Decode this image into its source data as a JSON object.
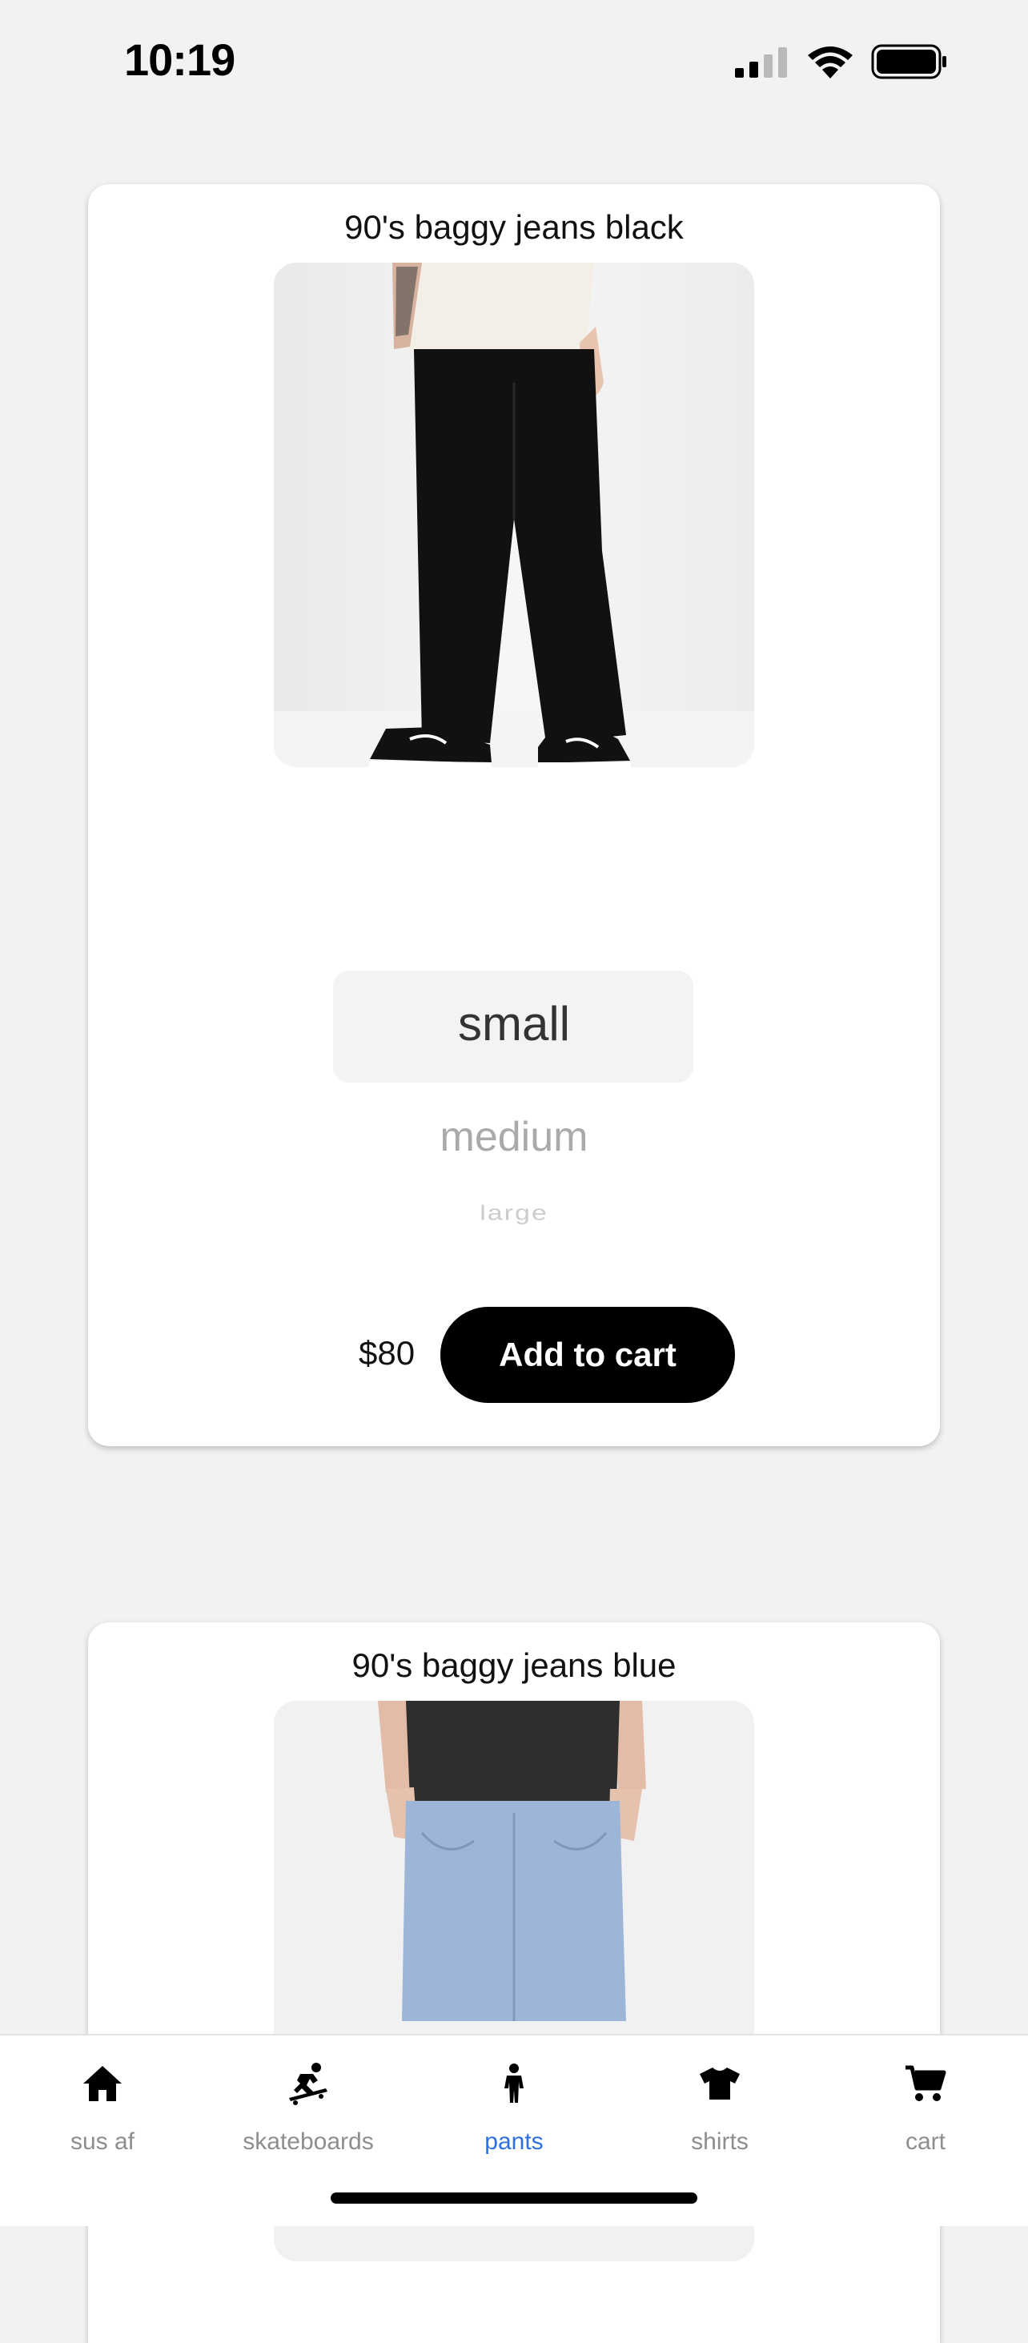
{
  "status_bar": {
    "time": "10:19"
  },
  "products": [
    {
      "title": "90's baggy jeans black",
      "sizes": [
        "small",
        "medium",
        "large"
      ],
      "selected_size": "small",
      "price": "$80",
      "add_label": "Add to cart"
    },
    {
      "title": "90's baggy jeans blue"
    }
  ],
  "tabs": [
    {
      "label": "sus af",
      "icon": "home-icon"
    },
    {
      "label": "skateboards",
      "icon": "skateboarder-icon"
    },
    {
      "label": "pants",
      "icon": "person-icon",
      "active": true
    },
    {
      "label": "shirts",
      "icon": "tshirt-icon"
    },
    {
      "label": "cart",
      "icon": "cart-icon"
    }
  ],
  "colors": {
    "active_tab": "#2f6fdf",
    "button": "#000000",
    "background": "#f2f2f2"
  }
}
